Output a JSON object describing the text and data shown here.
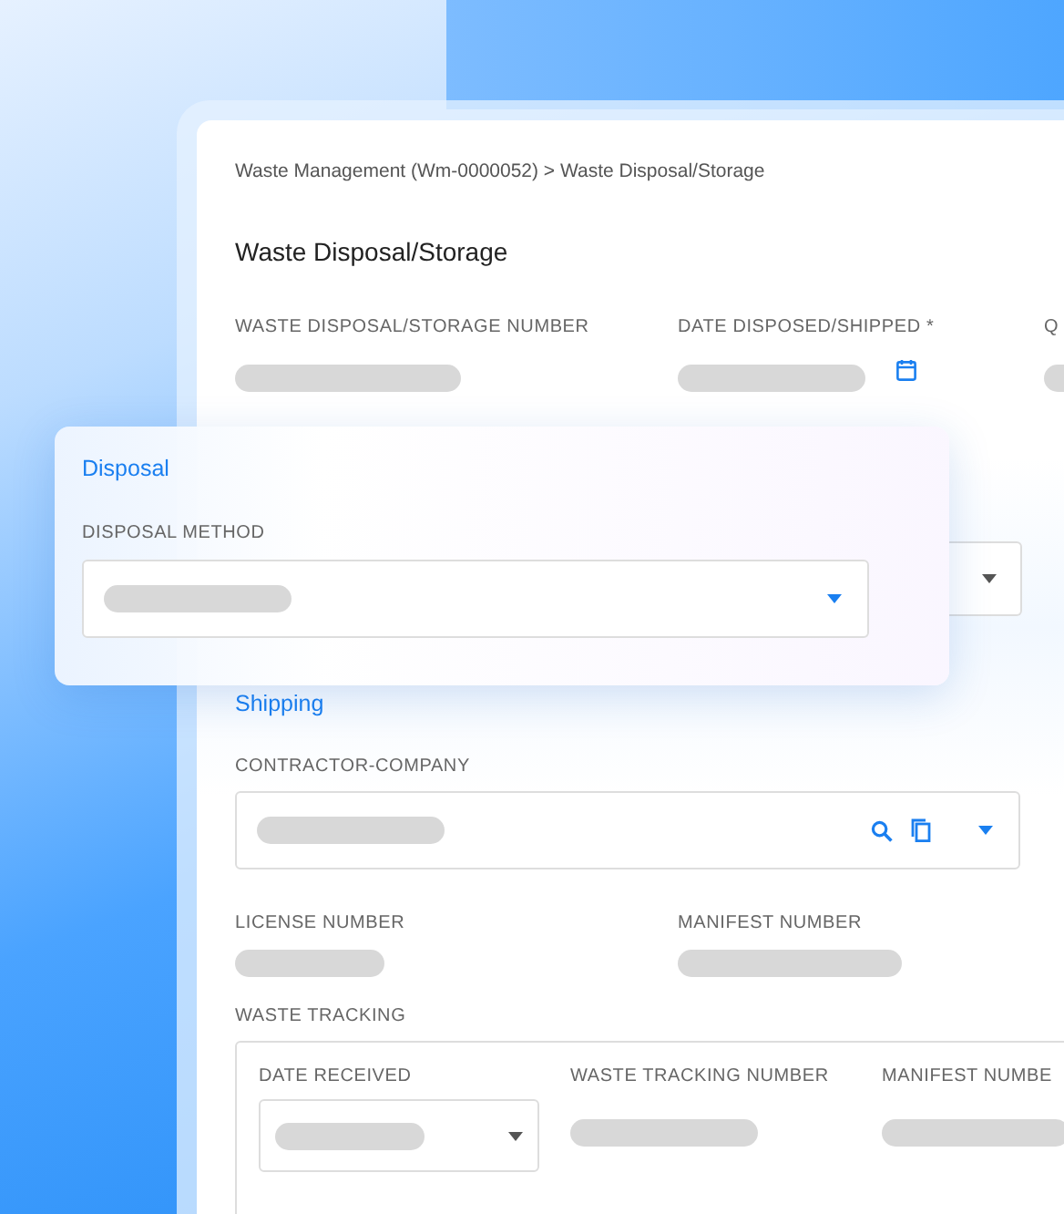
{
  "breadcrumb": "Waste Management (Wm-0000052) > Waste Disposal/Storage",
  "title": "Waste Disposal/Storage",
  "summary_fields": [
    {
      "label": "WASTE DISPOSAL/STORAGE NUMBER",
      "kind": "text"
    },
    {
      "label": "DATE DISPOSED/SHIPPED *",
      "kind": "date"
    },
    {
      "label": "Q",
      "kind": "text"
    }
  ],
  "disposal_panel": {
    "heading": "Disposal",
    "fields": [
      {
        "label": "DISPOSAL METHOD",
        "kind": "select"
      }
    ]
  },
  "shipping": {
    "heading": "Shipping",
    "contractor": {
      "label": "CONTRACTOR-COMPANY"
    },
    "fields": [
      {
        "label": "LICENSE NUMBER"
      },
      {
        "label": "MANIFEST NUMBER"
      }
    ]
  },
  "waste_tracking": {
    "label": "WASTE TRACKING",
    "columns": [
      {
        "label": "DATE RECEIVED",
        "kind": "select"
      },
      {
        "label": "WASTE TRACKING NUMBER",
        "kind": "text"
      },
      {
        "label": "MANIFEST NUMBE",
        "kind": "text"
      }
    ]
  }
}
